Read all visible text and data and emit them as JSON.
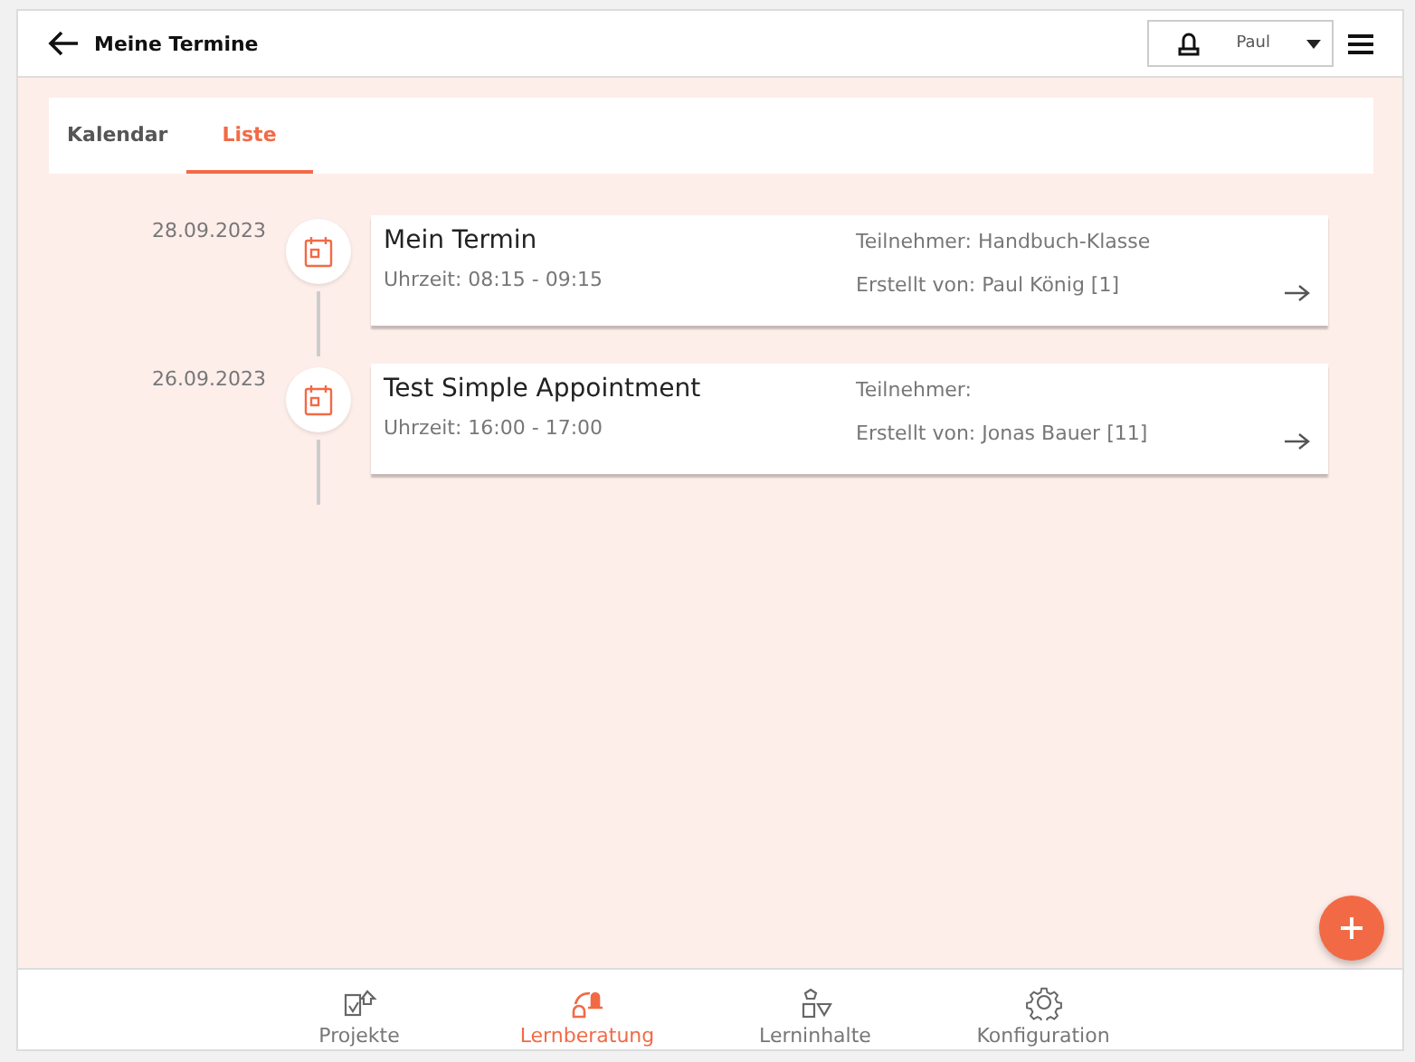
{
  "header": {
    "title": "Meine Termine",
    "user": "Paul"
  },
  "tabs": [
    {
      "label": "Kalendar",
      "selected": false
    },
    {
      "label": "Liste",
      "selected": true
    }
  ],
  "appointments": [
    {
      "date": "28.09.2023",
      "title": "Mein Termin",
      "time": "Uhrzeit: 08:15 - 09:15",
      "participants": "Teilnehmer: Handbuch-Klasse",
      "creator": "Erstellt von: Paul König [1]"
    },
    {
      "date": "26.09.2023",
      "title": "Test Simple Appointment",
      "time": "Uhrzeit: 16:00 - 17:00",
      "participants": "Teilnehmer:",
      "creator": "Erstellt von: Jonas Bauer [11]"
    }
  ],
  "nav": [
    {
      "kind": "projects",
      "label": "Projekte",
      "selected": false
    },
    {
      "kind": "counseling",
      "label": "Lernberatung",
      "selected": true
    },
    {
      "kind": "content",
      "label": "Lerninhalte",
      "selected": false
    },
    {
      "kind": "config",
      "label": "Konfiguration",
      "selected": false
    }
  ]
}
